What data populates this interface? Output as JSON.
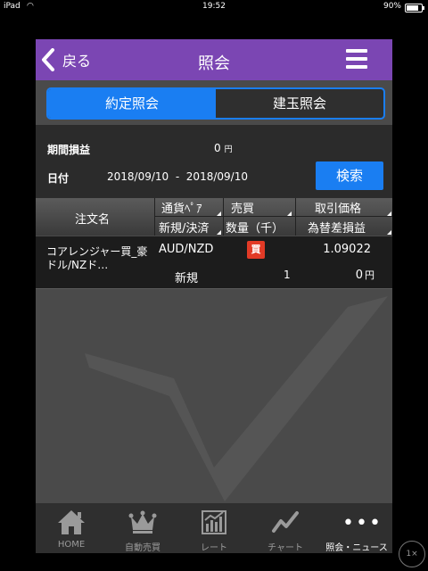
{
  "status_bar": {
    "device": "iPad",
    "time": "19:52",
    "battery": "90%"
  },
  "header": {
    "back_label": "戻る",
    "title": "照会"
  },
  "segments": {
    "active": "約定照会",
    "inactive": "建玉照会"
  },
  "summary": {
    "pl_label": "期間損益",
    "pl_value": "0",
    "pl_unit": "円",
    "date_label": "日付",
    "date_from": "2018/09/10",
    "date_sep": "-",
    "date_to": "2018/09/10",
    "search_label": "検索"
  },
  "table": {
    "headers": {
      "name": "注文名",
      "pair": "通貨ﾍﾟｱ",
      "side": "売買",
      "price": "取引価格",
      "kind": "新規/決済",
      "qty": "数量（千）",
      "pnl": "為替差損益"
    },
    "rows": [
      {
        "name": "コアレンジャー買_豪ドル/NZド…",
        "pair": "AUD/NZD",
        "side": "買",
        "price": "1.09022",
        "kind": "新規",
        "qty": "1",
        "pnl": "0",
        "pnl_unit": "円"
      }
    ]
  },
  "tabs": [
    {
      "label": "HOME",
      "icon": "home-icon"
    },
    {
      "label": "自動売買",
      "icon": "crown-icon"
    },
    {
      "label": "レート",
      "icon": "rate-chart-icon"
    },
    {
      "label": "チャート",
      "icon": "line-chart-icon"
    },
    {
      "label": "照会・ニュース",
      "icon": "more-dots-icon",
      "active": true
    }
  ],
  "zoom": "1×",
  "colors": {
    "header": "#7b46b3",
    "accent": "#1a7ef2",
    "buy": "#e23a26"
  }
}
